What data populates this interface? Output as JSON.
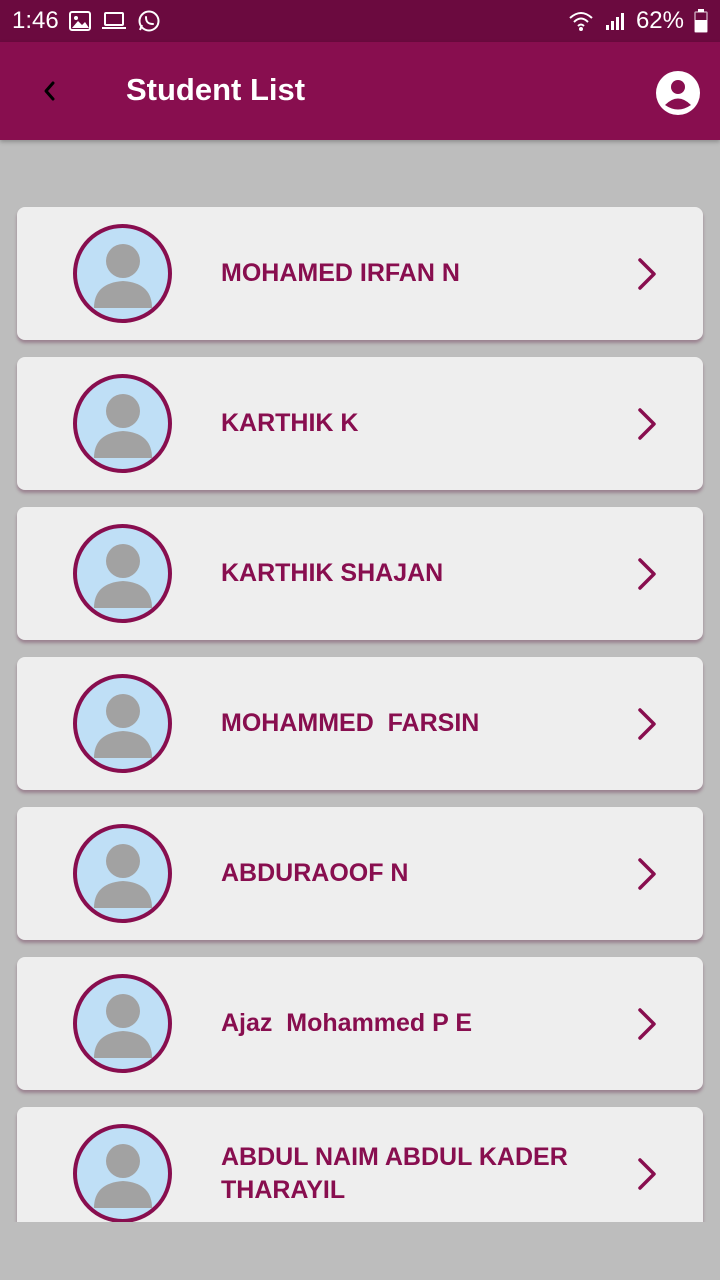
{
  "status_bar": {
    "time": "1:46",
    "battery": "62%",
    "icons_left": [
      "image-icon",
      "laptop-icon",
      "whatsapp-icon"
    ],
    "icons_right": [
      "wifi-icon",
      "signal-icon",
      "battery-icon"
    ]
  },
  "app_bar": {
    "title": "Student List",
    "back_icon": "chevron-left-icon",
    "profile_icon": "account-circle-icon"
  },
  "students": [
    {
      "name": "MOHAMED IRFAN N"
    },
    {
      "name": "KARTHIK K"
    },
    {
      "name": "KARTHIK SHAJAN"
    },
    {
      "name": "MOHAMMED  FARSIN"
    },
    {
      "name": "ABDURAOOF N"
    },
    {
      "name": "Ajaz  Mohammed P E"
    },
    {
      "name": "ABDUL NAIM ABDUL KADER THARAYIL"
    }
  ],
  "colors": {
    "primary": "#880e4f",
    "status_bar": "#6b0a3f",
    "background": "#bdbdbd",
    "card": "#eeeeee",
    "avatar_bg": "#bfdff6"
  }
}
